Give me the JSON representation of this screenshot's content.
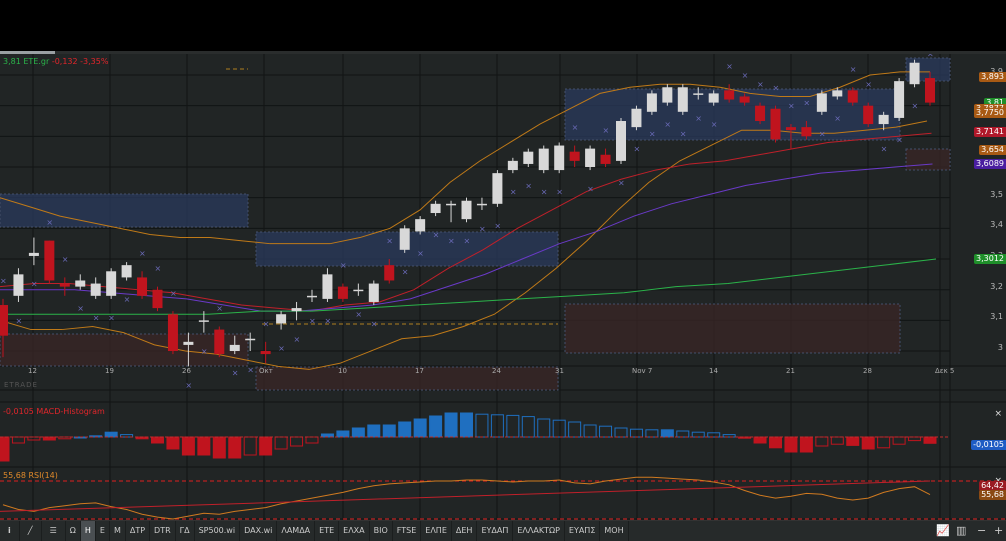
{
  "header": {
    "last": "3,81",
    "symbol": "ETE.gr",
    "change": "-0,132",
    "change_pct": "-3,35%"
  },
  "price_axis": {
    "ticks": [
      "3,9",
      "3,8",
      "3,7",
      "3,6",
      "3,5",
      "3,4",
      "3,3",
      "3,2",
      "3,1",
      "3"
    ],
    "tags": [
      {
        "text": "3,893",
        "color": "#a85a14",
        "price": 3.893
      },
      {
        "text": "3,81",
        "color": "#1f8f2a",
        "price": 3.81
      },
      {
        "text": "3,7877",
        "color": "#a85a14",
        "price": 3.7877
      },
      {
        "text": "3,7750",
        "color": "#a85a14",
        "price": 3.775
      },
      {
        "text": "3,7141",
        "color": "#b0182a",
        "price": 3.7141
      },
      {
        "text": "3,654",
        "color": "#a85a14",
        "price": 3.654
      },
      {
        "text": "3,6089",
        "color": "#4a1ea0",
        "price": 3.6089
      },
      {
        "text": "3,3012",
        "color": "#1f8f2a",
        "price": 3.3012
      }
    ]
  },
  "date_axis": [
    "12",
    "19",
    "26",
    "Окт",
    "10",
    "17",
    "24",
    "31",
    "Nov 7",
    "14",
    "21",
    "28",
    "Δεκ 5"
  ],
  "watermark": "ETRADE",
  "macd": {
    "label": "-0,0105 MACD-Histogram",
    "value_tag": "-0,0105",
    "close": "×"
  },
  "rsi": {
    "label": "55,68 RSI(14)",
    "tag_upper": "64,42",
    "tag_value": "55,68",
    "close": "×"
  },
  "colors": {
    "bg": "#212525",
    "up": "#d8d8d8",
    "down": "#c0141e",
    "accent": "#1f6fc0"
  },
  "chart_data": {
    "type": "candlestick",
    "ylim": [
      2.92,
      3.98
    ],
    "candles": [
      [
        3.15,
        3.17,
        2.98,
        3.05
      ],
      [
        3.18,
        3.27,
        3.16,
        3.25
      ],
      [
        3.31,
        3.37,
        3.28,
        3.32
      ],
      [
        3.36,
        3.36,
        3.22,
        3.23
      ],
      [
        3.22,
        3.24,
        3.18,
        3.21
      ],
      [
        3.21,
        3.25,
        3.2,
        3.23
      ],
      [
        3.18,
        3.24,
        3.17,
        3.22
      ],
      [
        3.18,
        3.27,
        3.17,
        3.26
      ],
      [
        3.24,
        3.29,
        3.23,
        3.28
      ],
      [
        3.24,
        3.26,
        3.17,
        3.18
      ],
      [
        3.2,
        3.21,
        3.13,
        3.14
      ],
      [
        3.12,
        3.13,
        2.99,
        3.0
      ],
      [
        3.02,
        3.06,
        2.95,
        3.03
      ],
      [
        3.1,
        3.13,
        3.06,
        3.1
      ],
      [
        3.07,
        3.08,
        2.98,
        2.99
      ],
      [
        3.0,
        3.05,
        2.99,
        3.02
      ],
      [
        3.04,
        3.06,
        3.0,
        3.04
      ],
      [
        3.0,
        3.03,
        2.96,
        2.99
      ],
      [
        3.09,
        3.13,
        3.07,
        3.12
      ],
      [
        3.13,
        3.16,
        3.1,
        3.14
      ],
      [
        3.18,
        3.2,
        3.16,
        3.18
      ],
      [
        3.17,
        3.27,
        3.16,
        3.25
      ],
      [
        3.21,
        3.22,
        3.16,
        3.17
      ],
      [
        3.2,
        3.22,
        3.18,
        3.2
      ],
      [
        3.16,
        3.23,
        3.15,
        3.22
      ],
      [
        3.28,
        3.3,
        3.22,
        3.23
      ],
      [
        3.33,
        3.41,
        3.32,
        3.4
      ],
      [
        3.39,
        3.44,
        3.38,
        3.43
      ],
      [
        3.45,
        3.49,
        3.44,
        3.48
      ],
      [
        3.48,
        3.49,
        3.42,
        3.48
      ],
      [
        3.43,
        3.5,
        3.42,
        3.49
      ],
      [
        3.48,
        3.5,
        3.46,
        3.48
      ],
      [
        3.48,
        3.59,
        3.47,
        3.58
      ],
      [
        3.59,
        3.63,
        3.58,
        3.62
      ],
      [
        3.61,
        3.66,
        3.6,
        3.65
      ],
      [
        3.59,
        3.67,
        3.58,
        3.66
      ],
      [
        3.59,
        3.68,
        3.58,
        3.67
      ],
      [
        3.65,
        3.67,
        3.6,
        3.62
      ],
      [
        3.6,
        3.67,
        3.59,
        3.66
      ],
      [
        3.64,
        3.66,
        3.6,
        3.61
      ],
      [
        3.62,
        3.76,
        3.61,
        3.75
      ],
      [
        3.73,
        3.8,
        3.72,
        3.79
      ],
      [
        3.78,
        3.85,
        3.77,
        3.84
      ],
      [
        3.81,
        3.87,
        3.8,
        3.86
      ],
      [
        3.78,
        3.87,
        3.77,
        3.86
      ],
      [
        3.84,
        3.86,
        3.82,
        3.84
      ],
      [
        3.81,
        3.85,
        3.8,
        3.84
      ],
      [
        3.85,
        3.87,
        3.81,
        3.82
      ],
      [
        3.83,
        3.84,
        3.8,
        3.81
      ],
      [
        3.8,
        3.81,
        3.74,
        3.75
      ],
      [
        3.79,
        3.8,
        3.68,
        3.69
      ],
      [
        3.73,
        3.74,
        3.66,
        3.72
      ],
      [
        3.73,
        3.75,
        3.69,
        3.7
      ],
      [
        3.78,
        3.85,
        3.77,
        3.84
      ],
      [
        3.83,
        3.86,
        3.82,
        3.85
      ],
      [
        3.85,
        3.86,
        3.8,
        3.81
      ],
      [
        3.8,
        3.81,
        3.73,
        3.74
      ],
      [
        3.74,
        3.78,
        3.72,
        3.77
      ],
      [
        3.76,
        3.89,
        3.75,
        3.88
      ],
      [
        3.87,
        3.95,
        3.86,
        3.94
      ],
      [
        3.89,
        3.91,
        3.8,
        3.81
      ]
    ],
    "bb_upper": [
      3.5,
      3.47,
      3.44,
      3.42,
      3.4,
      3.38,
      3.37,
      3.37,
      3.36,
      3.35,
      3.35,
      3.35,
      3.37,
      3.4,
      3.46,
      3.55,
      3.62,
      3.68,
      3.74,
      3.79,
      3.84,
      3.86,
      3.87,
      3.87,
      3.86,
      3.84,
      3.83,
      3.83,
      3.86,
      3.9,
      3.91,
      3.91
    ],
    "bb_lower": [
      3.1,
      3.07,
      3.07,
      3.08,
      3.06,
      3.02,
      3.0,
      2.99,
      2.97,
      2.95,
      2.94,
      2.96,
      3.0,
      3.04,
      3.05,
      3.08,
      3.12,
      3.19,
      3.27,
      3.36,
      3.46,
      3.55,
      3.62,
      3.67,
      3.72,
      3.72,
      3.71,
      3.71,
      3.72,
      3.73,
      3.75
    ],
    "ma_red": [
      3.21,
      3.22,
      3.22,
      3.21,
      3.2,
      3.19,
      3.17,
      3.15,
      3.14,
      3.13,
      3.15,
      3.16,
      3.2,
      3.27,
      3.33,
      3.4,
      3.46,
      3.52,
      3.56,
      3.59,
      3.61,
      3.62,
      3.64,
      3.66,
      3.68,
      3.69,
      3.7,
      3.71
    ],
    "ma_purple": [
      3.2,
      3.2,
      3.2,
      3.19,
      3.18,
      3.17,
      3.15,
      3.13,
      3.13,
      3.14,
      3.15,
      3.17,
      3.21,
      3.25,
      3.3,
      3.35,
      3.39,
      3.44,
      3.48,
      3.51,
      3.54,
      3.56,
      3.58,
      3.59,
      3.6,
      3.61
    ],
    "ma_green": [
      3.12,
      3.12,
      3.12,
      3.12,
      3.12,
      3.13,
      3.13,
      3.14,
      3.15,
      3.16,
      3.17,
      3.18,
      3.19,
      3.21,
      3.22,
      3.24,
      3.26,
      3.28,
      3.3
    ],
    "macd_hist": [
      -0.04,
      -0.01,
      -0.005,
      -0.005,
      -0.003,
      0,
      0.002,
      0.008,
      0.004,
      -0.003,
      -0.01,
      -0.02,
      -0.03,
      -0.03,
      -0.035,
      -0.035,
      -0.03,
      -0.03,
      -0.02,
      -0.015,
      -0.01,
      0.005,
      0.01,
      0.015,
      0.02,
      0.02,
      0.025,
      0.03,
      0.035,
      0.04,
      0.04,
      0.038,
      0.037,
      0.036,
      0.034,
      0.03,
      0.028,
      0.025,
      0.02,
      0.018,
      0.015,
      0.013,
      0.012,
      0.012,
      0.01,
      0.008,
      0.007,
      0.004,
      -0.002,
      -0.01,
      -0.018,
      -0.025,
      -0.025,
      -0.015,
      -0.012,
      -0.014,
      -0.02,
      -0.018,
      -0.012,
      -0.006,
      -0.0105
    ],
    "rsi": [
      45,
      40,
      38,
      42,
      44,
      46,
      47,
      43,
      40,
      35,
      32,
      30,
      33,
      36,
      35,
      38,
      40,
      42,
      46,
      49,
      52,
      55,
      58,
      62,
      65,
      67,
      68,
      69,
      70,
      70,
      71,
      71,
      70,
      69,
      70,
      70,
      71,
      68,
      67,
      70,
      72,
      74,
      74,
      73,
      72,
      71,
      69,
      66,
      60,
      55,
      52,
      54,
      57,
      56,
      52,
      50,
      52,
      58,
      62,
      64,
      55.68
    ]
  }
}
